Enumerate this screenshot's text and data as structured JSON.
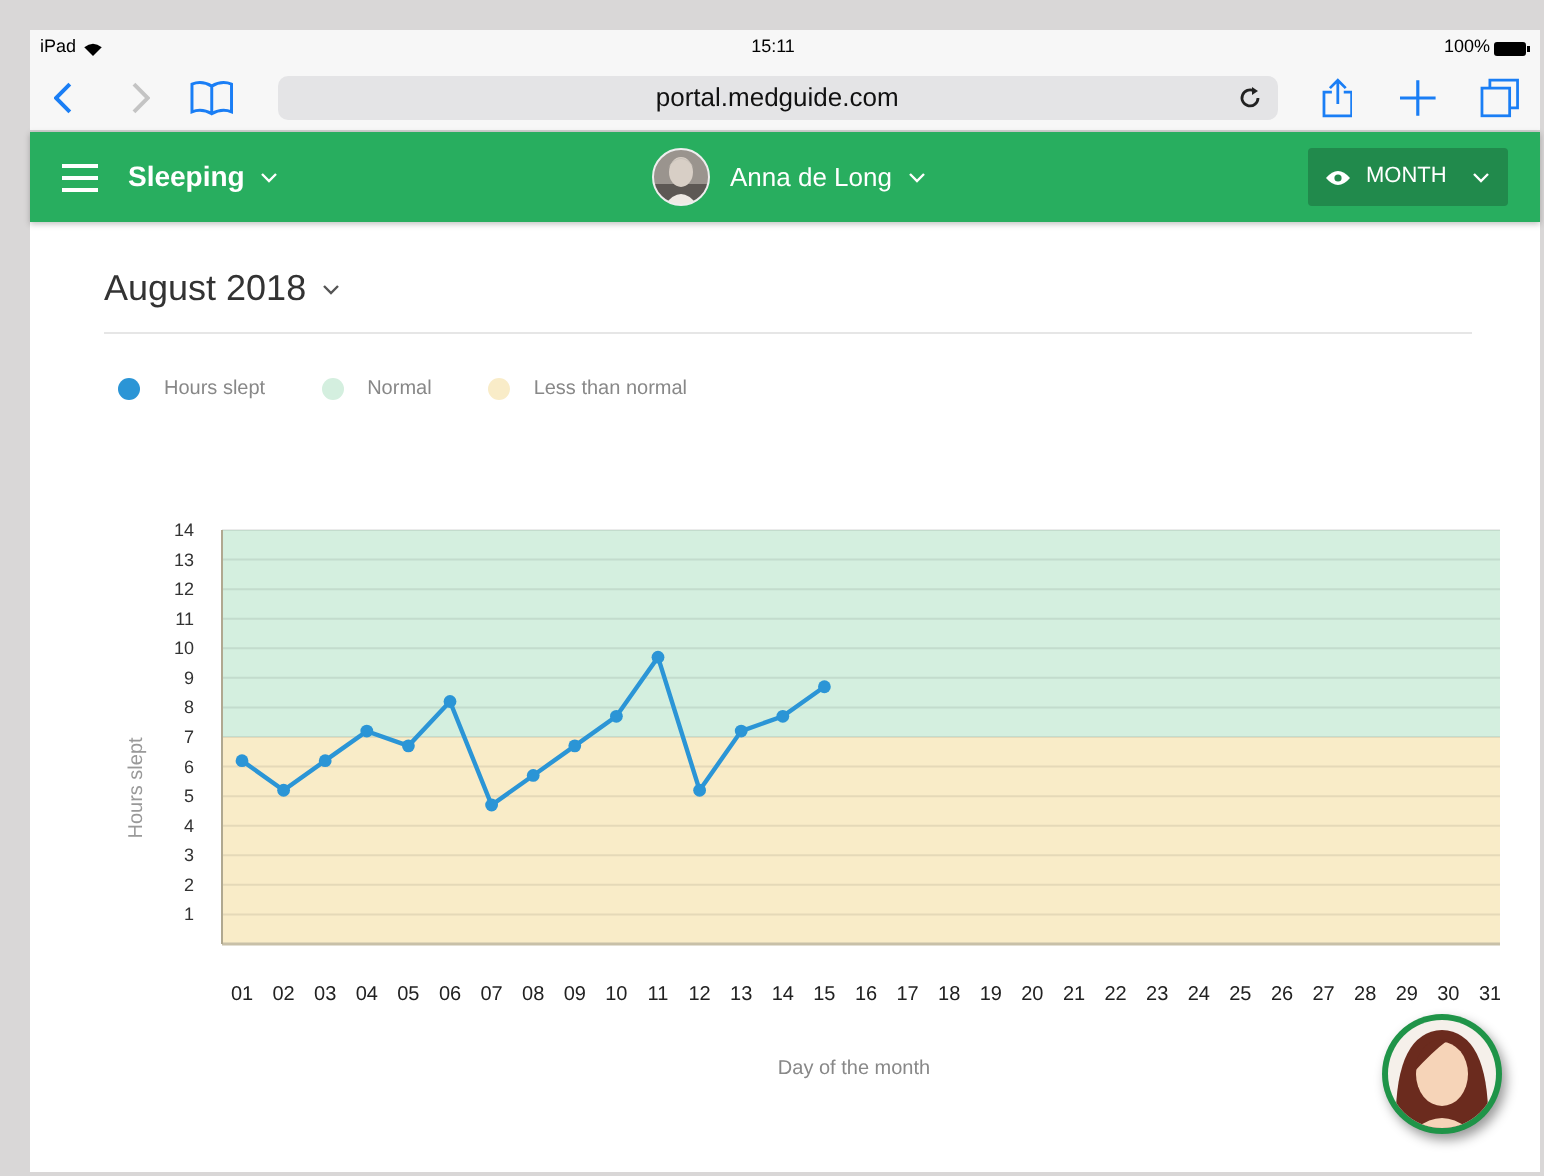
{
  "status_bar": {
    "device": "iPad",
    "time": "15:11",
    "battery": "100%"
  },
  "browser": {
    "url": "portal.medguide.com"
  },
  "nav": {
    "section": "Sleeping",
    "user": "Anna de Long",
    "view": "MONTH"
  },
  "heading": "August 2018",
  "chart_data": {
    "type": "line",
    "xlabel": "Day of the month",
    "ylabel": "Hours slept",
    "grid": true,
    "legend": "top",
    "categories": [
      "01",
      "02",
      "03",
      "04",
      "05",
      "06",
      "07",
      "08",
      "09",
      "10",
      "11",
      "12",
      "13",
      "14",
      "15",
      "16",
      "17",
      "18",
      "19",
      "20",
      "21",
      "22",
      "23",
      "24",
      "25",
      "26",
      "27",
      "28",
      "29",
      "30",
      "31"
    ],
    "ylim": [
      0,
      14
    ],
    "yticks": [
      1,
      2,
      3,
      4,
      5,
      6,
      7,
      8,
      9,
      10,
      11,
      12,
      13,
      14
    ],
    "series": [
      {
        "name": "Hours slept",
        "color": "#2b95d6",
        "marker": "circle",
        "values": [
          6.2,
          5.2,
          6.2,
          7.2,
          6.7,
          8.2,
          4.7,
          5.7,
          6.7,
          7.7,
          9.7,
          5.2,
          7.2,
          7.7,
          8.7,
          null,
          null,
          null,
          null,
          null,
          null,
          null,
          null,
          null,
          null,
          null,
          null,
          null,
          null,
          null,
          null
        ]
      }
    ],
    "bands": [
      {
        "label": "Normal",
        "axis": "y",
        "from": 7,
        "to": 14,
        "color": "#d4efdf"
      },
      {
        "label": "Less than normal",
        "axis": "y",
        "from": 0,
        "to": 7,
        "color": "#f9ecc8"
      }
    ]
  }
}
